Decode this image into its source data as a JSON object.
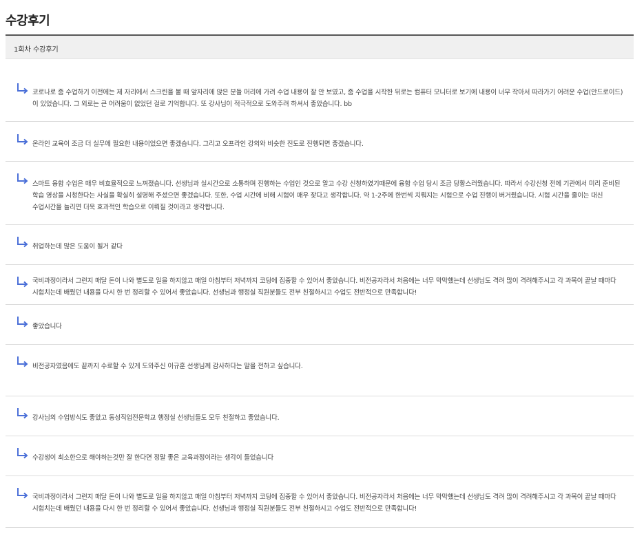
{
  "page": {
    "title": "수강후기"
  },
  "section": {
    "header": "1회차 수강후기"
  },
  "reviews": [
    {
      "icon": "reply-arrow-icon",
      "text": "코로나로 줌 수업하기 이전에는 제 자리에서 스크린을 볼 때 앞자리에 앉은 분들 머리에 가려 수업 내용이 잘 안 보였고, 줌 수업을 시작한 뒤로는 컴퓨터 모니터로 보기에 내용이 너무 작아서 따라가기 어려운 수업(안드로이드)이 있었습니다. 그 외로는 큰 어려움이 없었던 걸로 기억합니다. 또 강사님이 적극적으로 도와주려 하셔서 좋았습니다. bb"
    },
    {
      "icon": "reply-arrow-icon",
      "text": "온라인 교육이 조금 더 실무에 필요한 내용이었으면 좋겠습니다. 그리고 오프라인 강의와 비슷한 진도로 진행되면 좋겠습니다."
    },
    {
      "icon": "reply-arrow-icon",
      "text": "스마트 융합 수업은 매우 비효율적으로 느껴졌습니다. 선생님과 실시간으로 소통하며 진행하는 수업인 것으로 알고 수강 신청하였기때문에 융합 수업 당시 조금 당황스러웠습니다. 따라서 수강신청 전에 기관에서 미리 준비된 학습 영상을 시청한다는 사실을 확실히 설명해 주셨으면 좋겠습니다. 또한, 수업 시간에 비해 시험이 매우 잦다고 생각합니다. 약 1-2주에 한번씩 치뤄지는 시험으로 수업 진행이 버거웠습니다. 시험 시간을 줄이는 대신 수업시간을 늘리면 더욱 효과적인 학습으로 이뤄질 것이라고 생각합니다."
    },
    {
      "icon": "reply-arrow-icon",
      "text": "취업하는데 많은 도움이 될거 같다"
    },
    {
      "icon": "reply-arrow-icon",
      "text": "국비과정이라서 그런지 매달 돈이 나와 별도로 일을 하지않고 매일 아침부터 저녁까지 코딩에 집중할 수 있어서 좋았습니다. 비전공자라서 처음에는 너무 막막했는데 선생님도 격려 많이 격려해주시고 각 과목이 끝날 때마다 시험치는데 배웠던 내용을 다시 한 번 정리할 수 있어서 좋았습니다. 선생님과 행정실 직원분들도 전부 친절하시고 수업도 전반적으로 만족합니다!"
    },
    {
      "icon": "reply-arrow-icon",
      "text": "좋았습니다"
    },
    {
      "icon": "reply-arrow-icon",
      "text": "비전공자였음에도 끝까지 수료할 수 있게 도와주신 이규훈 선생님께 감사하다는 말을 전하고 싶습니다."
    },
    {
      "icon": "reply-arrow-icon",
      "text": "강사님의 수업방식도 좋았고 동성직업전문학교 행정실 선생님들도 모두 친절하고 좋았습니다."
    },
    {
      "icon": "reply-arrow-icon",
      "text": "수강생이 최소한으로 해야하는것만 잘 한다면 정말 좋은 교육과정이라는 생각이 들었습니다"
    },
    {
      "icon": "reply-arrow-icon",
      "text": "국비과정이라서 그런지 매달 돈이 나와 별도로 일을 하지않고 매일 아침부터 저녁까지 코딩에 집중할 수 있어서 좋았습니다. 비전공자라서 처음에는 너무 막막했는데 선생님도 격려 많이 격려해주시고 각 과목이 끝날 때마다 시험치는데 배웠던 내용을 다시 한 번 정리할 수 있어서 좋았습니다. 선생님과 행정실 직원분들도 전부 친절하시고 수업도 전반적으로 만족합니다!"
    }
  ],
  "colors": {
    "reply_icon": "#4a6fd8",
    "title_rule": "#555555",
    "header_bg": "#f0f0f0",
    "divider": "#dcdcdc"
  }
}
